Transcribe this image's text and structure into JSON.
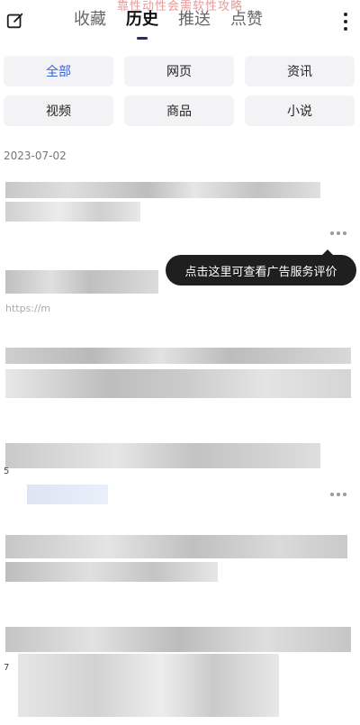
{
  "header": {
    "top_note": "靠性动性会需软性攻略",
    "tabs": [
      "收藏",
      "历史",
      "推送",
      "点赞"
    ],
    "active_tab": "历史"
  },
  "filters": [
    "全部",
    "网页",
    "资讯",
    "视频",
    "商品",
    "小说"
  ],
  "selected_filter": "全部",
  "date_header": "2023-07-02",
  "tooltip": "点击这里可查看广告服务评价",
  "items": [
    {
      "url_hint": "https://m"
    },
    {
      "url_hint": ""
    },
    {
      "num_hint": "5"
    },
    {
      "url_hint": ""
    },
    {
      "num_hint": "7"
    }
  ]
}
